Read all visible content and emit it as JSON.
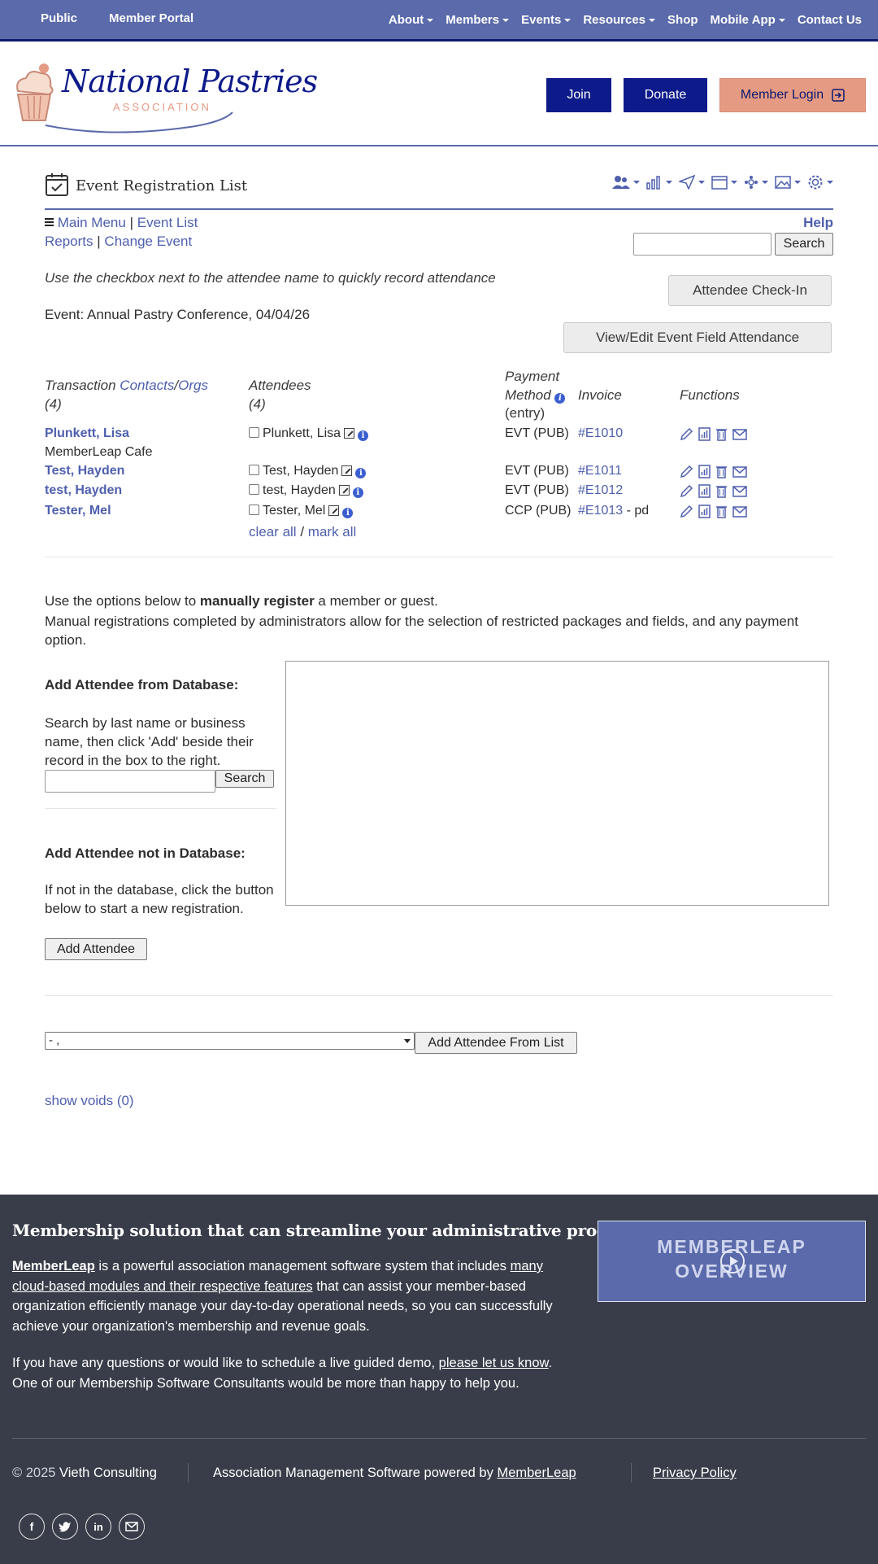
{
  "topnav": {
    "left": [
      "Public",
      "Member Portal"
    ],
    "items": [
      "About",
      "Members",
      "Events",
      "Resources",
      "Shop",
      "Mobile App",
      "Contact Us"
    ],
    "dropdown": [
      true,
      true,
      true,
      true,
      false,
      true,
      false
    ]
  },
  "header": {
    "logo_name": "National Pastries",
    "logo_sub": "ASSOCIATION",
    "join": "Join",
    "donate": "Donate",
    "login": "Member Login"
  },
  "page": {
    "title": "Event Registration List",
    "main_menu": "Main Menu",
    "sep": "|",
    "event_list": "Event List",
    "reports": "Reports",
    "change_event": "Change Event",
    "help": "Help",
    "search_btn": "Search",
    "hint": "Use the checkbox next to the attendee name to quickly record attendance",
    "checkin": "Attendee Check-In",
    "event": "Event: Annual Pastry Conference, 04/04/26",
    "view_edit": "View/Edit Event Field Attendance"
  },
  "table": {
    "h_transaction": "Transaction",
    "h_contacts": "Contacts",
    "h_slash": "/",
    "h_orgs": "Orgs",
    "h_count": "(4)",
    "h_attendees": "Attendees",
    "h_att_count": "(4)",
    "h_payment": "Payment",
    "h_method": "Method",
    "h_entry": "(entry)",
    "h_invoice": "Invoice",
    "h_functions": "Functions",
    "rows": [
      {
        "name": "Plunkett, Lisa",
        "org": "MemberLeap Cafe",
        "attendee": "Plunkett, Lisa",
        "method": "EVT (PUB)",
        "invoice": "#E1010",
        "suffix": ""
      },
      {
        "name": "Test, Hayden",
        "org": "",
        "attendee": "Test, Hayden",
        "method": "EVT (PUB)",
        "invoice": "#E1011",
        "suffix": ""
      },
      {
        "name": "test, Hayden",
        "org": "",
        "attendee": "test, Hayden",
        "method": "EVT (PUB)",
        "invoice": "#E1012",
        "suffix": ""
      },
      {
        "name": "Tester, Mel",
        "org": "",
        "attendee": "Tester, Mel",
        "method": "CCP (PUB)",
        "invoice": "#E1013",
        "suffix": " - pd"
      }
    ],
    "clear_all": "clear all",
    "slash": "/",
    "mark_all": "mark all"
  },
  "manual": {
    "l1_a": "Use the options below to ",
    "l1_b": "manually register",
    "l1_c": " a member or guest.",
    "l2": "Manual registrations completed by administrators allow for the selection of restricted packages and fields, and any payment option.",
    "db_title": "Add Attendee from Database:",
    "db_desc": "Search by last name or business name, then click 'Add' beside their record in the box to the right.",
    "search": "Search",
    "nodb_title": "Add Attendee not in Database:",
    "nodb_desc": "If not in the database, click the button below to start a new registration.",
    "add": "Add Attendee",
    "select_val": "- ,",
    "add_from_list": "Add Attendee From List",
    "voids": "show voids (0)"
  },
  "footer": {
    "title": "Membership solution that can streamline your administrative processes",
    "memberleap": "MemberLeap",
    "p1_a": " is a powerful association management software system that includes ",
    "p1_link": "many cloud-based modules and their respective features",
    "p1_b": " that can assist your member-based organization efficiently manage your day-to-day operational needs, so you can successfully achieve your organization's membership and revenue goals.",
    "p2_a": "If you have any questions or would like to schedule a live guided demo, ",
    "p2_link": "please let us know",
    "p2_b": ". One of our Membership Software Consultants would be more than happy to help you.",
    "video_l1": "MEMBERLEAP",
    "video_l2": "OVERVIEW",
    "copy": "© 2025 ",
    "vieth": "Vieth Consulting",
    "powered": "Association Management Software powered by ",
    "ml": "MemberLeap",
    "privacy": "Privacy Policy"
  }
}
